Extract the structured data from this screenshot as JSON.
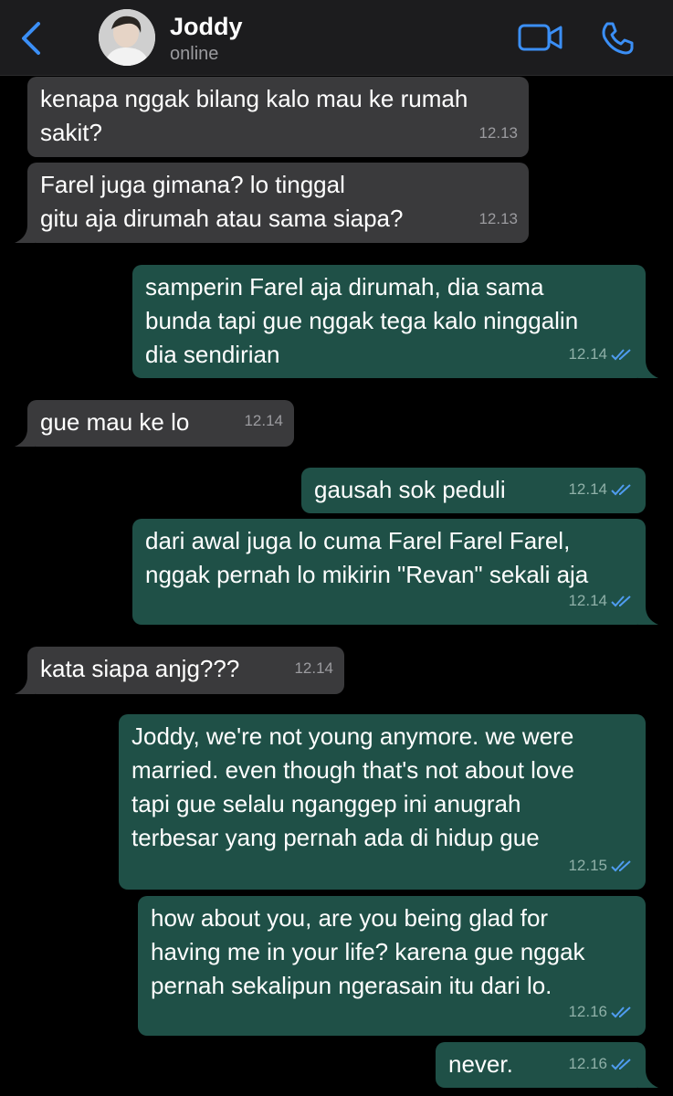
{
  "header": {
    "back_icon": "chevron-left-icon",
    "contact_name": "Joddy",
    "contact_status": "online",
    "video_icon": "video-camera-icon",
    "call_icon": "phone-icon",
    "accent_color": "#3b8ff6"
  },
  "messages": [
    {
      "dir": "in",
      "text": "kenapa nggak bilang kalo mau ke rumah\nsakit?",
      "time": "12.13"
    },
    {
      "dir": "in",
      "text": "Farel juga gimana? lo tinggal\ngitu aja dirumah atau sama siapa?",
      "time": "12.13"
    },
    {
      "dir": "out",
      "text": "samperin Farel aja dirumah, dia sama\nbunda tapi gue nggak tega kalo ninggalin\ndia sendirian",
      "time": "12.14"
    },
    {
      "dir": "in",
      "text": "gue mau ke lo",
      "time": "12.14"
    },
    {
      "dir": "out",
      "text": "gausah sok peduli",
      "time": "12.14"
    },
    {
      "dir": "out",
      "text": "dari awal juga lo cuma Farel Farel Farel,\nnggak pernah lo mikirin \"Revan\" sekali aja",
      "time": "12.14"
    },
    {
      "dir": "in",
      "text": "kata siapa anjg???",
      "time": "12.14"
    },
    {
      "dir": "out",
      "text": "Joddy, we're not young anymore. we were\nmarried. even though that's not about love\ntapi gue selalu nganggep ini anugrah\nterbesar yang pernah ada di hidup gue",
      "time": "12.15"
    },
    {
      "dir": "out",
      "text": "how about you, are you being glad for\nhaving me in your life? karena gue nggak\npernah sekalipun ngerasain itu dari lo.",
      "time": "12.16"
    },
    {
      "dir": "out",
      "text": "never.",
      "time": "12.16"
    }
  ],
  "colors": {
    "incoming_bubble": "#3a3a3c",
    "outgoing_bubble": "#1f5047",
    "read_tick": "#4f9cf0"
  }
}
